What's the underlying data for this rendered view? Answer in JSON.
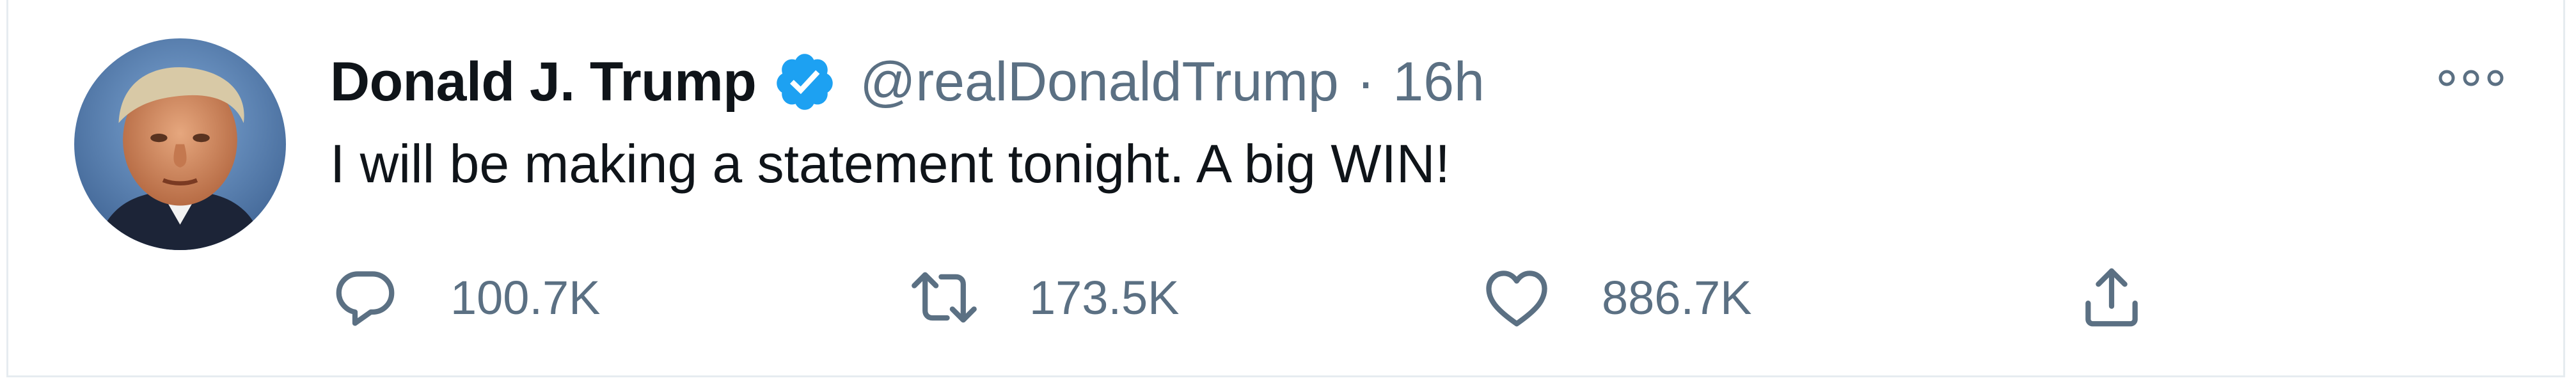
{
  "tweet": {
    "author": {
      "name": "Donald J. Trump",
      "handle": "@realDonaldTrump",
      "verified": true,
      "avatar": "avatar-photo"
    },
    "separator": "·",
    "timestamp": "16h",
    "text": "I will be making a statement tonight. A big WIN!",
    "actions": {
      "reply": {
        "icon": "reply-icon",
        "count": "100.7K"
      },
      "retweet": {
        "icon": "retweet-icon",
        "count": "173.5K"
      },
      "like": {
        "icon": "heart-icon",
        "count": "886.7K"
      },
      "share": {
        "icon": "share-icon"
      }
    },
    "more_menu": {
      "icon": "more-dots-icon"
    }
  },
  "colors": {
    "text_primary": "#0f1419",
    "text_secondary": "#5b7083",
    "verified_blue": "#1da1f2",
    "border": "#e6ecf0"
  }
}
